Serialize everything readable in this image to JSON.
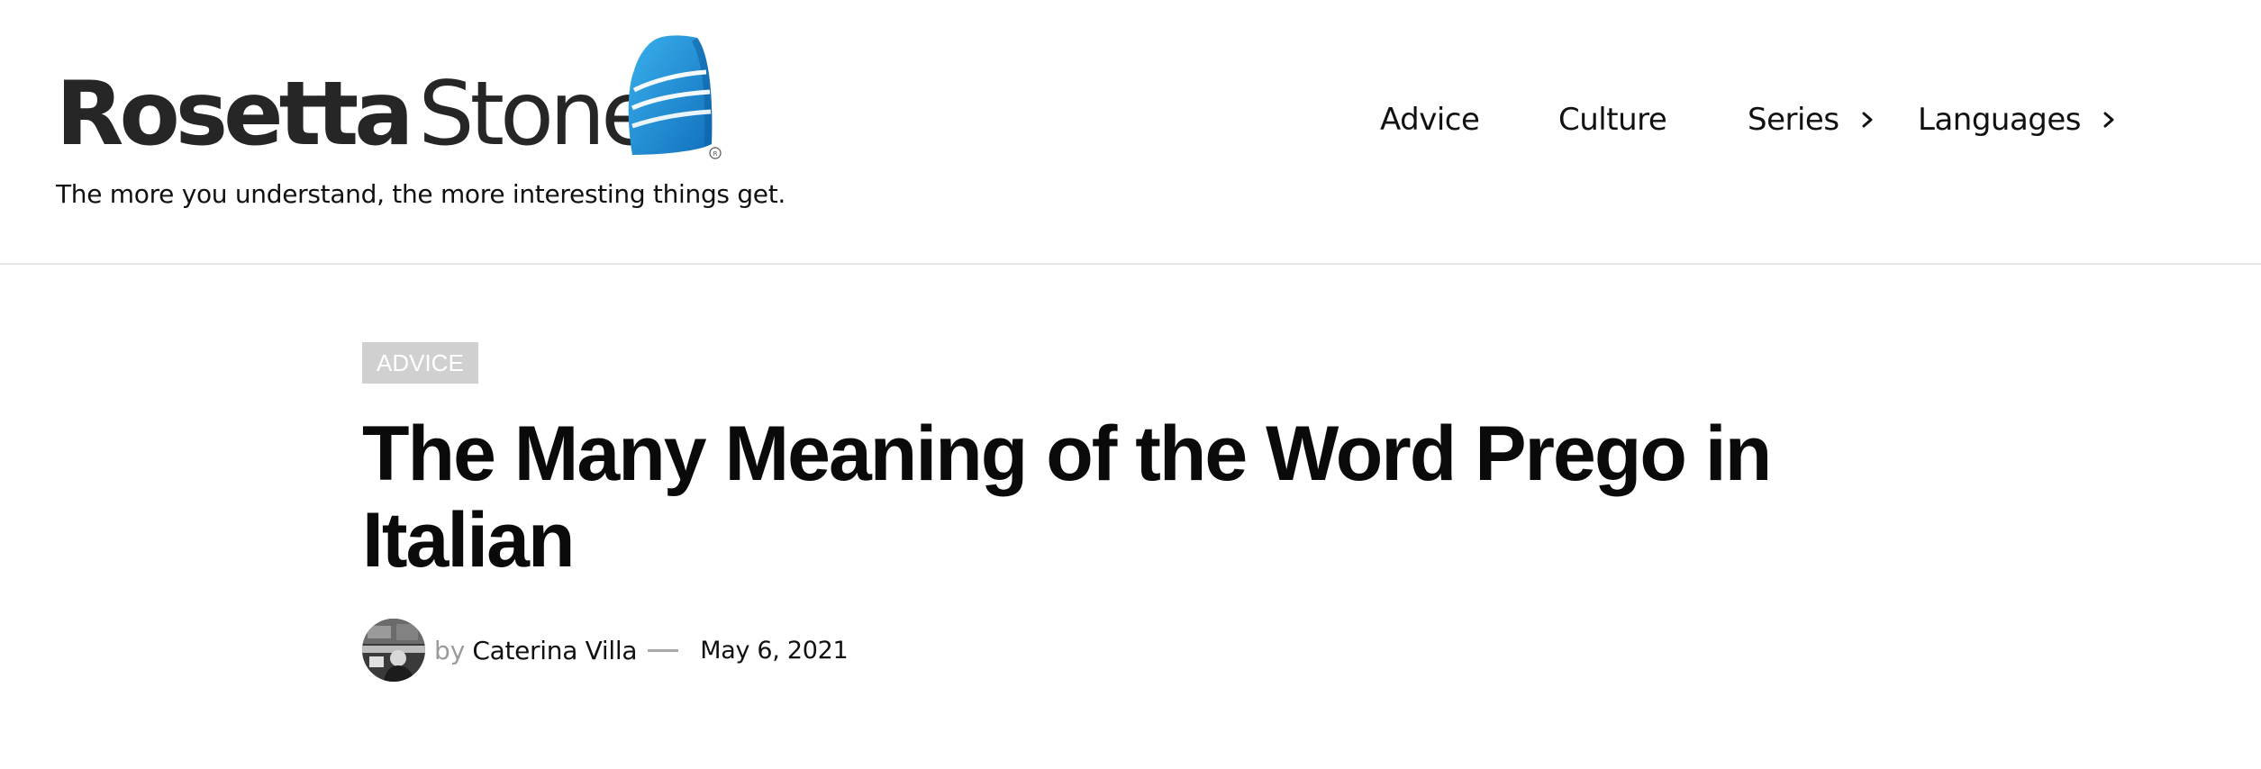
{
  "brand": {
    "name_bold": "Rosetta",
    "name_light": "Stone",
    "tagline": "The more you understand, the more interesting things get.",
    "logo_icon": "rosetta-stone-logo-icon",
    "logo_colors": [
      "#1a86d4",
      "#3ab0ec",
      "#0d5fa3"
    ]
  },
  "nav": {
    "items": [
      {
        "label": "Advice",
        "has_submenu": false
      },
      {
        "label": "Culture",
        "has_submenu": false
      },
      {
        "label": "Series",
        "has_submenu": true,
        "icon": "chevron-right-icon"
      },
      {
        "label": "Languages",
        "has_submenu": true,
        "icon": "chevron-right-icon"
      }
    ]
  },
  "article": {
    "category": "ADVICE",
    "title": "The Many Meaning of the Word Prego in Italian",
    "author_prefix": "by",
    "author": "Caterina Villa",
    "date": "May 6, 2021"
  },
  "colors": {
    "badge_bg": "#d0d0d0",
    "header_border": "#e6e6e6",
    "muted_text": "#9a9a9a"
  }
}
